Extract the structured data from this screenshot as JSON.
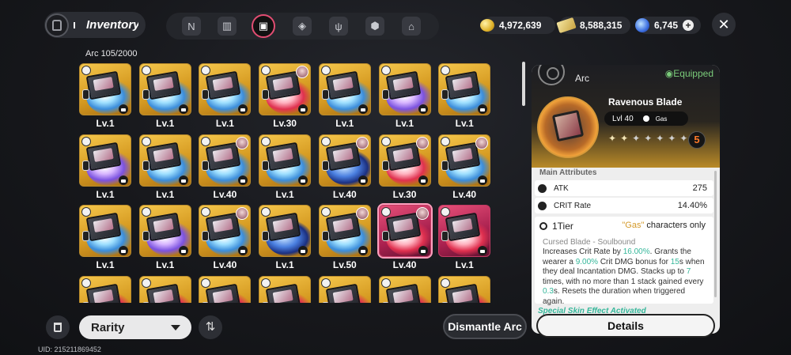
{
  "header": {
    "title": "Inventory"
  },
  "nav_tabs": [
    {
      "icon": "anomaly-icon"
    },
    {
      "icon": "device-icon"
    },
    {
      "icon": "arc-icon",
      "active": true
    },
    {
      "icon": "box-icon"
    },
    {
      "icon": "food-icon"
    },
    {
      "icon": "cube-icon"
    },
    {
      "icon": "home-icon"
    }
  ],
  "currencies": [
    {
      "icon": "gold-coin-icon",
      "value": "4,972,639"
    },
    {
      "icon": "ticket-icon",
      "value": "8,588,315"
    },
    {
      "icon": "gem-icon",
      "value": "6,745"
    }
  ],
  "arc_count": {
    "label": "Arc",
    "value": "105/2000"
  },
  "items": [
    {
      "level": "Lv.1",
      "rarity": "gold",
      "fx": "blue"
    },
    {
      "level": "Lv.1",
      "rarity": "gold",
      "fx": "blue"
    },
    {
      "level": "Lv.1",
      "rarity": "gold",
      "fx": "blue"
    },
    {
      "level": "Lv.30",
      "rarity": "gold",
      "fx": "red",
      "avatar": true
    },
    {
      "level": "Lv.1",
      "rarity": "gold",
      "fx": "blue"
    },
    {
      "level": "Lv.1",
      "rarity": "gold",
      "fx": "purple"
    },
    {
      "level": "Lv.1",
      "rarity": "gold",
      "fx": "blue"
    },
    {
      "level": "Lv.1",
      "rarity": "gold",
      "fx": "purple"
    },
    {
      "level": "Lv.1",
      "rarity": "gold",
      "fx": "blue"
    },
    {
      "level": "Lv.40",
      "rarity": "gold",
      "fx": "blue",
      "avatar": true
    },
    {
      "level": "Lv.1",
      "rarity": "gold",
      "fx": "blue"
    },
    {
      "level": "Lv.40",
      "rarity": "gold",
      "fx": "dark",
      "avatar": true
    },
    {
      "level": "Lv.30",
      "rarity": "gold",
      "fx": "red",
      "avatar": true
    },
    {
      "level": "Lv.40",
      "rarity": "gold",
      "fx": "blue",
      "avatar": true
    },
    {
      "level": "Lv.1",
      "rarity": "gold",
      "fx": "blue"
    },
    {
      "level": "Lv.1",
      "rarity": "gold",
      "fx": "purple"
    },
    {
      "level": "Lv.40",
      "rarity": "gold",
      "fx": "blue",
      "avatar": true
    },
    {
      "level": "Lv.1",
      "rarity": "gold",
      "fx": "dark"
    },
    {
      "level": "Lv.50",
      "rarity": "gold",
      "fx": "blue",
      "avatar": true
    },
    {
      "level": "Lv.40",
      "rarity": "red",
      "fx": "red",
      "avatar": true,
      "selected": true
    },
    {
      "level": "Lv.1",
      "rarity": "red",
      "fx": "red"
    },
    {
      "level": "",
      "rarity": "gold",
      "fx": "red"
    },
    {
      "level": "",
      "rarity": "gold",
      "fx": "red"
    },
    {
      "level": "",
      "rarity": "gold",
      "fx": "red"
    },
    {
      "level": "",
      "rarity": "gold",
      "fx": "red"
    },
    {
      "level": "",
      "rarity": "gold",
      "fx": "red"
    },
    {
      "level": "",
      "rarity": "gold",
      "fx": "red"
    },
    {
      "level": "",
      "rarity": "gold",
      "fx": "red"
    }
  ],
  "toolbar": {
    "rarity_label": "Rarity",
    "dismantle_label": "Dismantle Arc",
    "uid": "UID: 215211869452"
  },
  "detail": {
    "category": "Arc",
    "equipped": "Equipped",
    "name": "Ravenous Blade",
    "level": "Lvl 40",
    "element": "Gas",
    "stars_filled": 2,
    "stars_total": 7,
    "breakthrough": "5",
    "main_attributes_label": "Main Attributes",
    "attributes": [
      {
        "name": "ATK",
        "value": "275"
      },
      {
        "name": "CRIT Rate",
        "value": "14.40%"
      }
    ],
    "tier": "1Tier",
    "restriction_quote": "\"Gas\"",
    "restriction_tail": "characters only",
    "skill_name": "Cursed Blade - Soulbound",
    "desc": {
      "p1": "Increases Crit Rate by ",
      "v1": "16.00%",
      "p2": ". Grants the wearer a ",
      "v2": "9.00%",
      "p3": " Crit DMG bonus for ",
      "v3": "15",
      "p4": "s when they deal Incantation DMG. Stacks up to ",
      "v4": "7",
      "p5": " times, with no more than 1 stack gained every ",
      "v5": "0.3",
      "p6": "s. Resets the duration when triggered again."
    },
    "special": "Special Skin Effect Activated",
    "details_button": "Details"
  }
}
